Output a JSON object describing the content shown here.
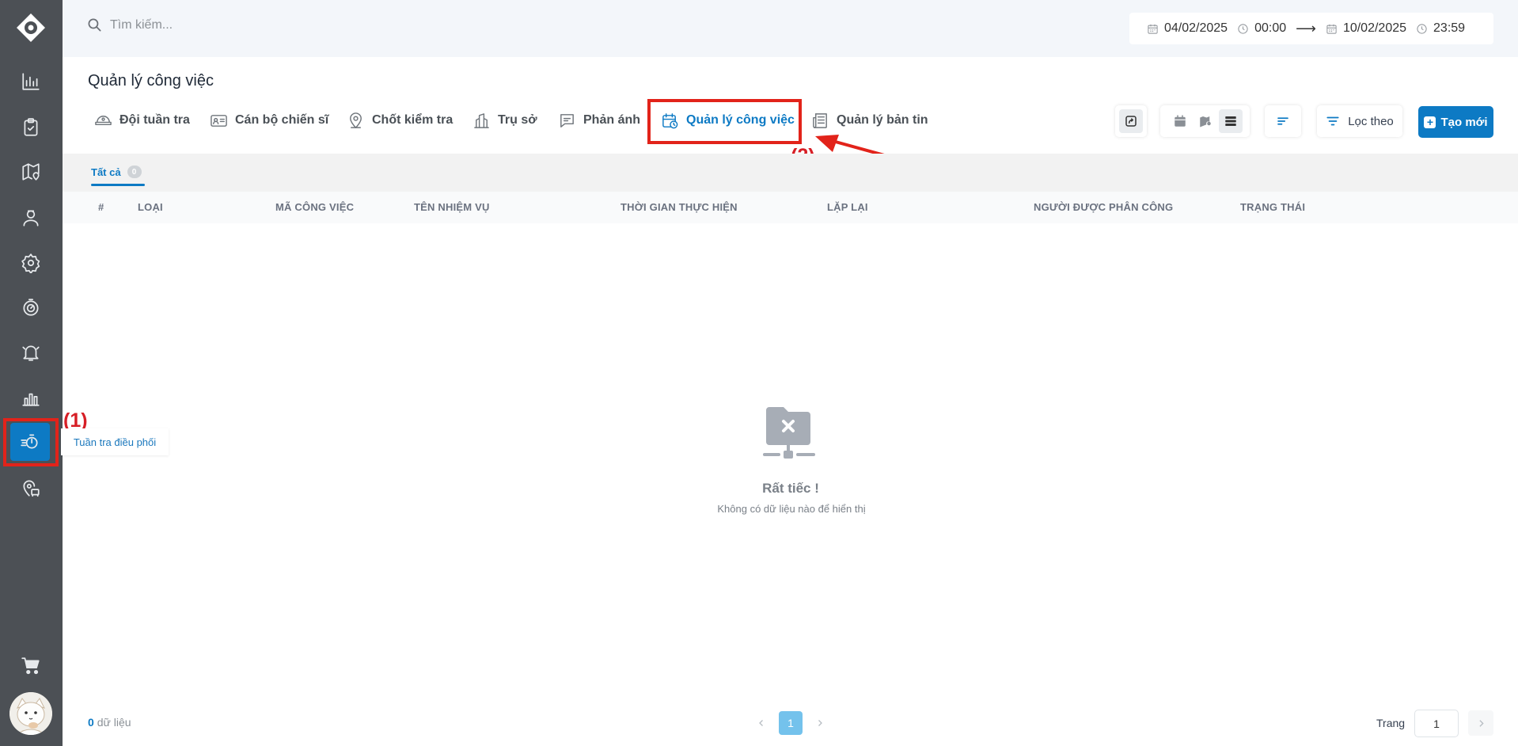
{
  "sidebar": {
    "items": [
      {
        "name": "dashboard-icon"
      },
      {
        "name": "clipboard-check-icon"
      },
      {
        "name": "map-pin-icon"
      },
      {
        "name": "users-icon"
      },
      {
        "name": "settings-icon"
      },
      {
        "name": "timer-icon"
      },
      {
        "name": "bell-icon"
      },
      {
        "name": "bar-chart-icon"
      },
      {
        "name": "patrol-dispatch-icon",
        "active": true
      },
      {
        "name": "location-bus-icon"
      }
    ],
    "cart_icon": "cart-icon",
    "tooltip": "Tuần tra điều phối"
  },
  "annotations": {
    "step1": "(1)",
    "step2": "(2)"
  },
  "search": {
    "placeholder": "Tìm kiếm..."
  },
  "date_range": {
    "start_date": "04/02/2025",
    "start_time": "00:00",
    "arrow": "⟶",
    "end_date": "10/02/2025",
    "end_time": "23:59"
  },
  "page_title": "Quản lý công việc",
  "tabs": [
    {
      "label": "Đội tuần tra",
      "icon": "patrol-cap-icon"
    },
    {
      "label": "Cán bộ chiến sĩ",
      "icon": "id-card-icon"
    },
    {
      "label": "Chốt kiểm tra",
      "icon": "location-icon"
    },
    {
      "label": "Trụ sở",
      "icon": "building-icon"
    },
    {
      "label": "Phản ánh",
      "icon": "message-icon"
    },
    {
      "label": "Quản lý công việc",
      "icon": "calendar-clock-icon",
      "active": true
    },
    {
      "label": "Quản lý bản tin",
      "icon": "newspaper-icon"
    }
  ],
  "toolbar": {
    "filter_label": "Lọc theo",
    "create_label": "Tạo mới",
    "create_plus": "+",
    "view_modes": [
      "calendar-view-icon",
      "map-view-icon",
      "list-view-icon"
    ],
    "selected_view": "list-view-icon"
  },
  "subtabs": [
    {
      "label": "Tất cả",
      "count": "0"
    }
  ],
  "table": {
    "columns": [
      "#",
      "LOẠI",
      "MÃ CÔNG VIỆC",
      "TÊN NHIỆM VỤ",
      "THỜI GIAN THỰC HIỆN",
      "LẶP LẠI",
      "NGƯỜI ĐƯỢC PHÂN CÔNG",
      "TRẠNG THÁI"
    ],
    "rows": []
  },
  "empty_state": {
    "title": "Rất tiếc !",
    "subtitle": "Không có dữ liệu nào để hiển thị"
  },
  "footer": {
    "count": "0",
    "count_label": "dữ liệu",
    "current_page": "1",
    "page_label": "Trang",
    "page_input": "1"
  },
  "colors": {
    "sidebar_bg": "#4c5055",
    "accent": "#0d7ac4",
    "annotation": "#e2231a"
  }
}
